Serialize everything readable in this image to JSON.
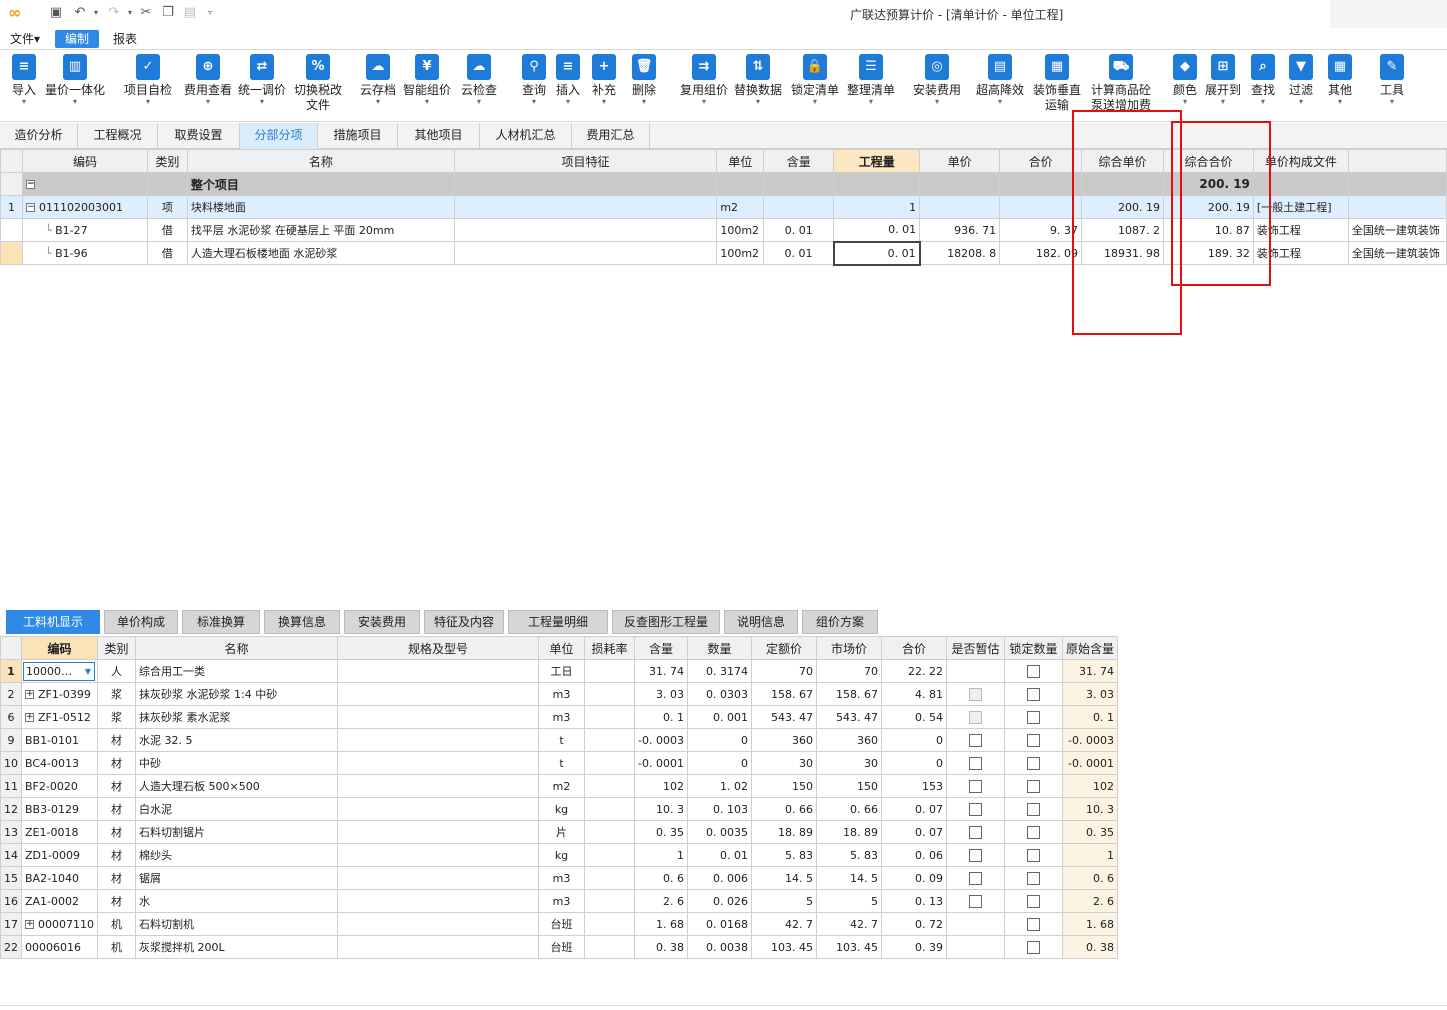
{
  "window": {
    "title": "广联达预算计价 - [清单计价 - 单位工程]"
  },
  "menu": [
    {
      "label": "文件▾"
    },
    {
      "label": "编制",
      "active": true
    },
    {
      "label": "报表"
    }
  ],
  "ribbon": [
    {
      "label": "导入",
      "icon": "import-icon",
      "glyph": "≡"
    },
    {
      "label": "量价一体化",
      "icon": "integration-icon",
      "glyph": "▥"
    },
    {
      "label": "项目自检",
      "icon": "self-check-icon",
      "glyph": "✓"
    },
    {
      "label": "费用查看",
      "icon": "cost-view-icon",
      "glyph": "⊕"
    },
    {
      "label": "统一调价",
      "icon": "unify-price-icon",
      "glyph": "⇄"
    },
    {
      "label": "切换税改",
      "label2": "文件",
      "icon": "tax-switch-icon",
      "glyph": "%"
    },
    {
      "label": "云存档",
      "icon": "cloud-archive-icon",
      "glyph": "☁"
    },
    {
      "label": "智能组价",
      "icon": "smart-price-icon",
      "glyph": "¥"
    },
    {
      "label": "云检查",
      "icon": "cloud-check-icon",
      "glyph": "☁"
    },
    {
      "label": "查询",
      "icon": "query-icon",
      "glyph": "⚲"
    },
    {
      "label": "插入",
      "icon": "insert-icon",
      "glyph": "≡"
    },
    {
      "label": "补充",
      "icon": "supplement-icon",
      "glyph": "+"
    },
    {
      "label": "删除",
      "icon": "delete-icon",
      "glyph": "🗑"
    },
    {
      "label": "复用组价",
      "icon": "reuse-price-icon",
      "glyph": "⇉"
    },
    {
      "label": "替换数据",
      "icon": "replace-data-icon",
      "glyph": "⇅"
    },
    {
      "label": "锁定清单",
      "icon": "lock-list-icon",
      "glyph": "🔒"
    },
    {
      "label": "整理清单",
      "icon": "organize-list-icon",
      "glyph": "☰"
    },
    {
      "label": "安装费用",
      "icon": "install-fee-icon",
      "glyph": "◎"
    },
    {
      "label": "超高降效",
      "icon": "high-efficiency-icon",
      "glyph": "▤"
    },
    {
      "label": "装饰垂直",
      "label2": "运输",
      "icon": "vertical-transport-icon",
      "glyph": "▦"
    },
    {
      "label": "计算商品砼",
      "label2": "泵送增加费",
      "icon": "concrete-pump-icon",
      "glyph": "⛟"
    },
    {
      "label": "颜色",
      "icon": "color-icon",
      "glyph": "◆"
    },
    {
      "label": "展开到",
      "icon": "expand-to-icon",
      "glyph": "⊞"
    },
    {
      "label": "查找",
      "icon": "find-icon",
      "glyph": "⌕"
    },
    {
      "label": "过滤",
      "icon": "filter-icon",
      "glyph": "▼"
    },
    {
      "label": "其他",
      "icon": "other-icon",
      "glyph": "▦"
    },
    {
      "label": "工具",
      "icon": "tools-icon",
      "glyph": "✎"
    }
  ],
  "tabs": [
    {
      "label": "造价分析"
    },
    {
      "label": "工程概况"
    },
    {
      "label": "取费设置"
    },
    {
      "label": "分部分项",
      "active": true
    },
    {
      "label": "措施项目"
    },
    {
      "label": "其他项目"
    },
    {
      "label": "人材机汇总"
    },
    {
      "label": "费用汇总"
    }
  ],
  "top_grid": {
    "headers": [
      "编码",
      "类别",
      "名称",
      "项目特征",
      "单位",
      "含量",
      "工程量",
      "单价",
      "合价",
      "综合单价",
      "综合合价",
      "单价构成文件"
    ],
    "group": {
      "label": "整个项目",
      "total": "200. 19"
    },
    "rows": [
      {
        "num": "1",
        "code": "011102003001",
        "type": "项",
        "name": "块料楼地面",
        "feature": "",
        "unit": "m2",
        "content": "",
        "qty": "1",
        "price": "",
        "total": "",
        "uprice": "200. 19",
        "utotal": "200. 19",
        "file": "[一般土建工程]"
      },
      {
        "num": "",
        "code": "B1-27",
        "type": "借",
        "name": "找平层 水泥砂浆 在硬基层上 平面 20mm",
        "feature": "",
        "unit": "100m2",
        "content": "0. 01",
        "qty": "0. 01",
        "price": "936. 71",
        "total": "9. 37",
        "uprice": "1087. 2",
        "utotal": "10. 87",
        "file": "装饰工程",
        "extra": "全国统一建筑装饰"
      },
      {
        "num": "",
        "code": "B1-96",
        "type": "借",
        "name": "人造大理石板楼地面 水泥砂浆",
        "feature": "",
        "unit": "100m2",
        "content": "0. 01",
        "qty": "0. 01",
        "price": "18208. 8",
        "total": "182. 09",
        "uprice": "18931. 98",
        "utotal": "189. 32",
        "file": "装饰工程",
        "extra": "全国统一建筑装饰"
      }
    ]
  },
  "bottom_tabs": [
    {
      "label": "工料机显示",
      "active": true
    },
    {
      "label": "单价构成"
    },
    {
      "label": "标准换算"
    },
    {
      "label": "换算信息"
    },
    {
      "label": "安装费用"
    },
    {
      "label": "特征及内容"
    },
    {
      "label": "工程量明细"
    },
    {
      "label": "反查图形工程量"
    },
    {
      "label": "说明信息"
    },
    {
      "label": "组价方案"
    }
  ],
  "bottom_grid": {
    "headers": [
      "编码",
      "类别",
      "名称",
      "规格及型号",
      "单位",
      "损耗率",
      "含量",
      "数量",
      "定额价",
      "市场价",
      "合价",
      "是否暂估",
      "锁定数量",
      "原始含量"
    ],
    "rows": [
      {
        "num": "1",
        "code": "10000…",
        "type": "人",
        "name": "综合用工一类",
        "unit": "工日",
        "content": "31. 74",
        "amount": "0. 3174",
        "quota": "70",
        "market": "70",
        "total": "22. 22",
        "est": "none",
        "lock": "box",
        "orig": "31. 74",
        "combo": true
      },
      {
        "num": "2",
        "code": "ZF1-0399",
        "type": "浆",
        "name": "抹灰砂浆 水泥砂浆 1:4 中砂",
        "unit": "m3",
        "content": "3. 03",
        "amount": "0. 0303",
        "quota": "158. 67",
        "market": "158. 67",
        "total": "4. 81",
        "est": "dis",
        "lock": "box",
        "orig": "3. 03",
        "expand": true
      },
      {
        "num": "6",
        "code": "ZF1-0512",
        "type": "浆",
        "name": "抹灰砂浆 素水泥浆",
        "unit": "m3",
        "content": "0. 1",
        "amount": "0. 001",
        "quota": "543. 47",
        "market": "543. 47",
        "total": "0. 54",
        "est": "dis",
        "lock": "box",
        "orig": "0. 1",
        "expand": true
      },
      {
        "num": "9",
        "code": "BB1-0101",
        "type": "材",
        "name": "水泥 32. 5",
        "unit": "t",
        "content": "-0. 0003",
        "amount": "0",
        "quota": "360",
        "market": "360",
        "total": "0",
        "est": "box",
        "lock": "box",
        "orig": "-0. 0003"
      },
      {
        "num": "10",
        "code": "BC4-0013",
        "type": "材",
        "name": "中砂",
        "unit": "t",
        "content": "-0. 0001",
        "amount": "0",
        "quota": "30",
        "market": "30",
        "total": "0",
        "est": "box",
        "lock": "box",
        "orig": "-0. 0001"
      },
      {
        "num": "11",
        "code": "BF2-0020",
        "type": "材",
        "name": "人造大理石板 500×500",
        "unit": "m2",
        "content": "102",
        "amount": "1. 02",
        "quota": "150",
        "market": "150",
        "total": "153",
        "est": "box",
        "lock": "box",
        "orig": "102"
      },
      {
        "num": "12",
        "code": "BB3-0129",
        "type": "材",
        "name": "白水泥",
        "unit": "kg",
        "content": "10. 3",
        "amount": "0. 103",
        "quota": "0. 66",
        "market": "0. 66",
        "total": "0. 07",
        "est": "box",
        "lock": "box",
        "orig": "10. 3"
      },
      {
        "num": "13",
        "code": "ZE1-0018",
        "type": "材",
        "name": "石料切割锯片",
        "unit": "片",
        "content": "0. 35",
        "amount": "0. 0035",
        "quota": "18. 89",
        "market": "18. 89",
        "total": "0. 07",
        "est": "box",
        "lock": "box",
        "orig": "0. 35"
      },
      {
        "num": "14",
        "code": "ZD1-0009",
        "type": "材",
        "name": "棉纱头",
        "unit": "kg",
        "content": "1",
        "amount": "0. 01",
        "quota": "5. 83",
        "market": "5. 83",
        "total": "0. 06",
        "est": "box",
        "lock": "box",
        "orig": "1"
      },
      {
        "num": "15",
        "code": "BA2-1040",
        "type": "材",
        "name": "锯屑",
        "unit": "m3",
        "content": "0. 6",
        "amount": "0. 006",
        "quota": "14. 5",
        "market": "14. 5",
        "total": "0. 09",
        "est": "box",
        "lock": "box",
        "orig": "0. 6"
      },
      {
        "num": "16",
        "code": "ZA1-0002",
        "type": "材",
        "name": "水",
        "unit": "m3",
        "content": "2. 6",
        "amount": "0. 026",
        "quota": "5",
        "market": "5",
        "total": "0. 13",
        "est": "box",
        "lock": "box",
        "orig": "2. 6"
      },
      {
        "num": "17",
        "code": "00007110",
        "type": "机",
        "name": "石料切割机",
        "unit": "台班",
        "content": "1. 68",
        "amount": "0. 0168",
        "quota": "42. 7",
        "market": "42. 7",
        "total": "0. 72",
        "est": "none",
        "lock": "box",
        "orig": "1. 68",
        "expand": true
      },
      {
        "num": "22",
        "code": "00006016",
        "type": "机",
        "name": "灰浆搅拌机 200L",
        "unit": "台班",
        "content": "0. 38",
        "amount": "0. 0038",
        "quota": "103. 45",
        "market": "103. 45",
        "total": "0. 39",
        "est": "none",
        "lock": "box",
        "orig": "0. 38"
      }
    ]
  },
  "colors": {
    "accent": "#2e8ae6",
    "highlight_border": "#e01010",
    "group_row": "#c9c9c9"
  }
}
